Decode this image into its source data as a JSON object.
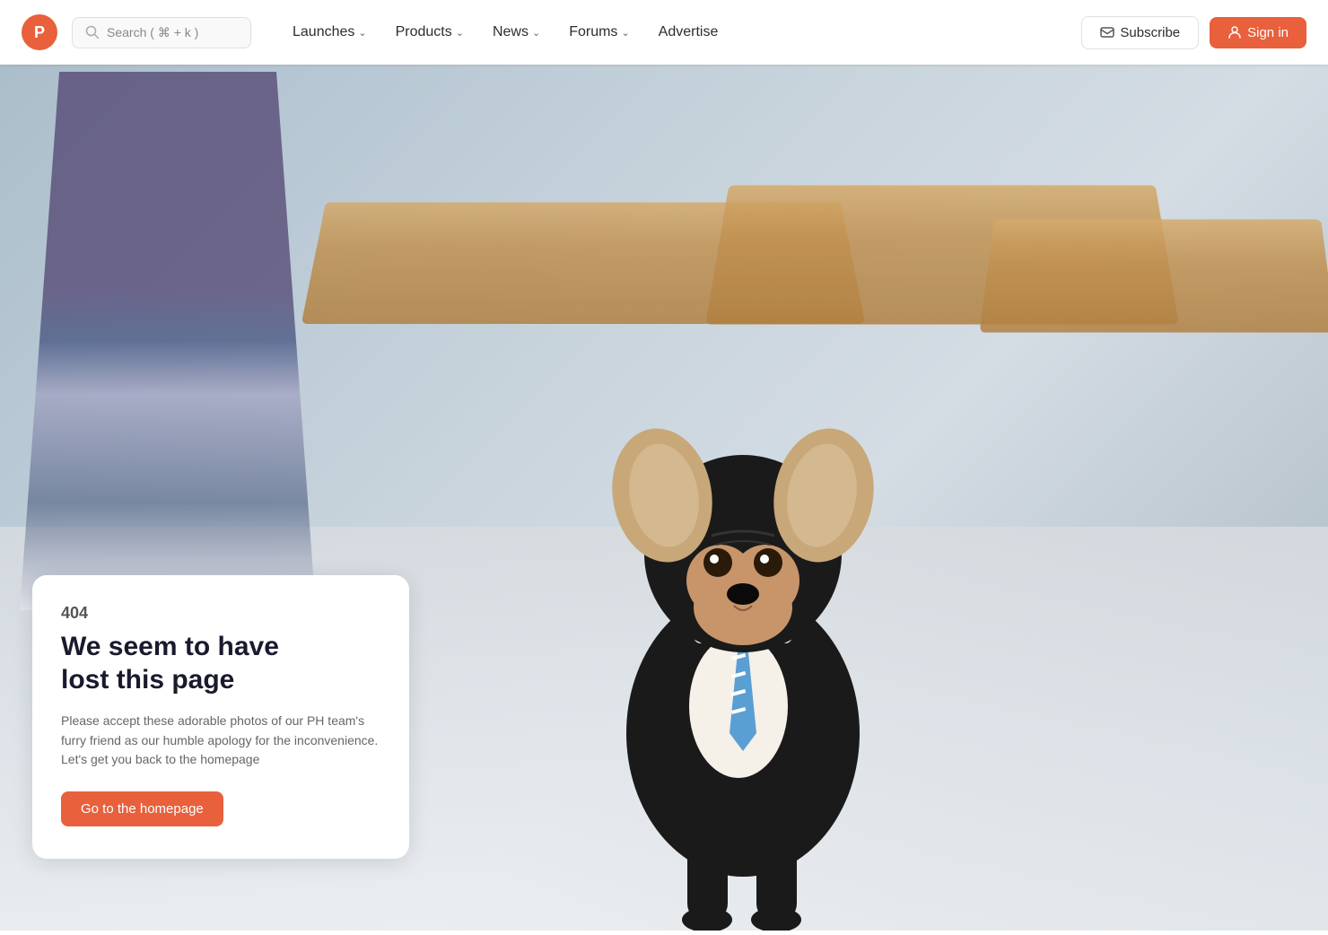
{
  "brand": {
    "logo_letter": "P",
    "logo_color": "#e8603c"
  },
  "search": {
    "placeholder": "Search ( ⌘ + k )",
    "shortcut": "⌘ + k"
  },
  "nav": {
    "items": [
      {
        "id": "launches",
        "label": "Launches",
        "has_dropdown": true
      },
      {
        "id": "products",
        "label": "Products",
        "has_dropdown": true
      },
      {
        "id": "news",
        "label": "News",
        "has_dropdown": true
      },
      {
        "id": "forums",
        "label": "Forums",
        "has_dropdown": true
      },
      {
        "id": "advertise",
        "label": "Advertise",
        "has_dropdown": false
      }
    ]
  },
  "buttons": {
    "subscribe_label": "Subscribe",
    "signin_label": "Sign in"
  },
  "error": {
    "code": "404",
    "title_line1": "We seem to have",
    "title_line2": "lost this page",
    "description": "Please accept these adorable photos of our PH team's furry friend as our humble apology for the inconvenience. Let's get you back to the homepage",
    "cta_label": "Go to the homepage"
  }
}
